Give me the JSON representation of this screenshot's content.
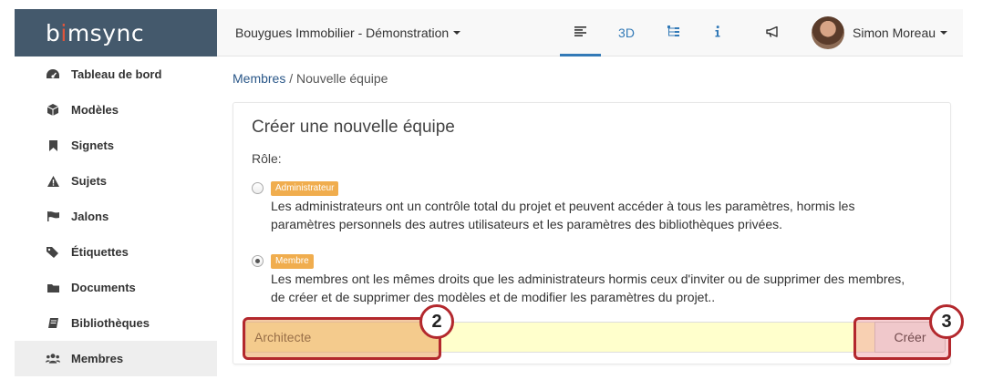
{
  "app": {
    "logo_prefix": "b",
    "logo_pin": "i",
    "logo_suffix": "msync"
  },
  "sidebar": {
    "items": [
      {
        "label": "Tableau de bord",
        "icon": "dashboard-icon"
      },
      {
        "label": "Modèles",
        "icon": "cube-icon"
      },
      {
        "label": "Signets",
        "icon": "bookmark-icon"
      },
      {
        "label": "Sujets",
        "icon": "warning-icon"
      },
      {
        "label": "Jalons",
        "icon": "flag-icon"
      },
      {
        "label": "Étiquettes",
        "icon": "tags-icon"
      },
      {
        "label": "Documents",
        "icon": "folder-icon"
      },
      {
        "label": "Bibliothèques",
        "icon": "book-icon"
      },
      {
        "label": "Membres",
        "icon": "users-icon",
        "active": true
      }
    ]
  },
  "topbar": {
    "project": "Bouygues Immobilier - Démonstration",
    "btn_3d": "3D",
    "user_name": "Simon Moreau"
  },
  "breadcrumb": {
    "parent": "Membres",
    "separator": " / ",
    "current": "Nouvelle équipe"
  },
  "form": {
    "title": "Créer une nouvelle équipe",
    "role_label": "Rôle:",
    "roles": [
      {
        "badge": "Administrateur",
        "line1": "Les administrateurs ont un contrôle total du projet et peuvent accéder à tous les paramètres, hormis les",
        "line2": "paramètres personnels des autres utilisateurs et les paramètres des bibliothèques privées.",
        "checked": false
      },
      {
        "badge": "Membre",
        "line1": "Les membres ont les mêmes droits que les administrateurs hormis ceux d'inviter ou de supprimer des membres,",
        "line2": "de créer et de supprimer des modèles et de modifier les paramètres du projet..",
        "checked": true
      }
    ],
    "team_name_value": "Architecte",
    "create_label": "Créer"
  },
  "callouts": {
    "first": "2",
    "second": "3"
  },
  "colors": {
    "header_bg": "#44596c",
    "accent": "#337ab7",
    "badge": "#f0ad4e",
    "callout": "#b3282d",
    "input_bg": "#ffffcc"
  }
}
